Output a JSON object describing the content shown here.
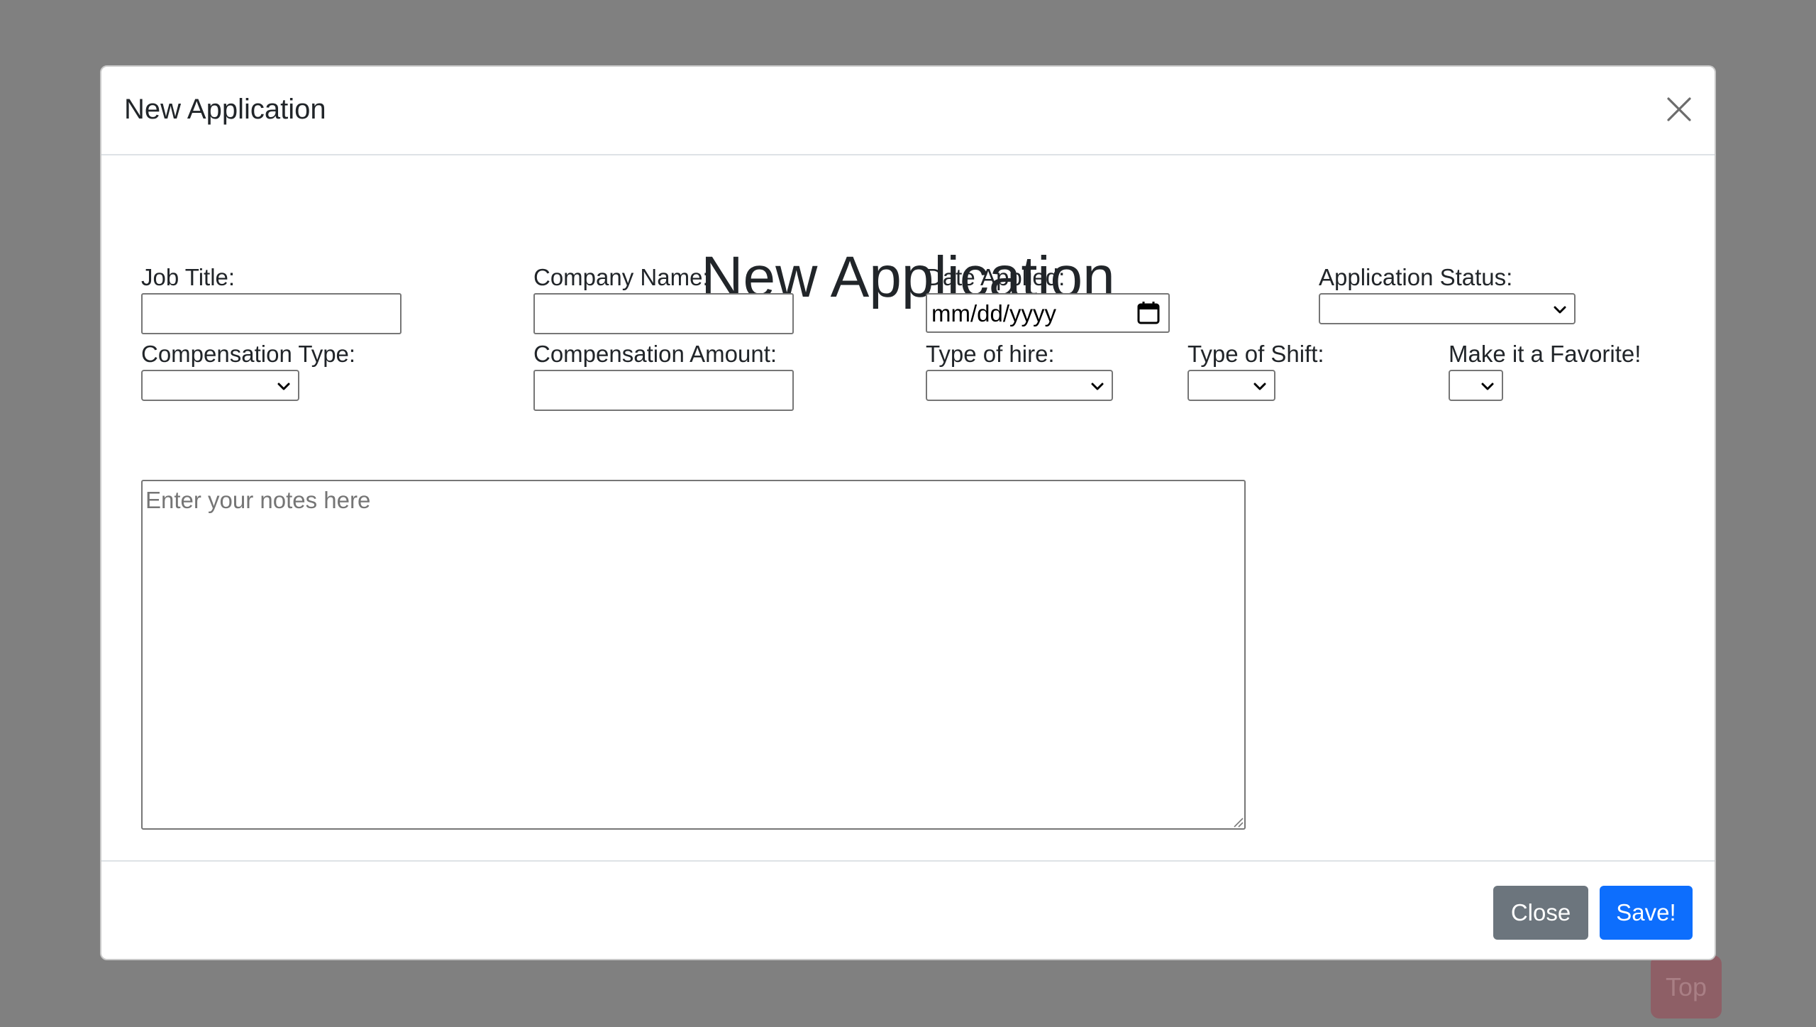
{
  "modal": {
    "title": "New Application",
    "heading": "New Application"
  },
  "icons": {
    "close": "close-icon",
    "calendar": "calendar-icon",
    "chevron": "chevron-down-icon",
    "resize": "resize-grip-icon"
  },
  "form": {
    "job_title": {
      "label": "Job Title:",
      "value": ""
    },
    "company_name": {
      "label": "Company Name:",
      "value": ""
    },
    "date_applied": {
      "label": "Date Applied:",
      "value": "mm/dd/yyyy"
    },
    "application_status": {
      "label": "Application Status:",
      "value": ""
    },
    "compensation_type": {
      "label": "Compensation Type:",
      "value": ""
    },
    "compensation_amount": {
      "label": "Compensation Amount:",
      "value": ""
    },
    "type_of_hire": {
      "label": "Type of hire:",
      "value": ""
    },
    "type_of_shift": {
      "label": "Type of Shift:",
      "value": ""
    },
    "favorite": {
      "label": "Make it a Favorite!",
      "value": ""
    },
    "notes": {
      "placeholder": "Enter your notes here",
      "value": ""
    }
  },
  "footer": {
    "close_label": "Close",
    "save_label": "Save!"
  },
  "page": {
    "top_label": "Top"
  },
  "colors": {
    "backdrop": "#808080",
    "primary": "#0d6efd",
    "secondary": "#6c757d",
    "top_button": "#8e5f66"
  }
}
